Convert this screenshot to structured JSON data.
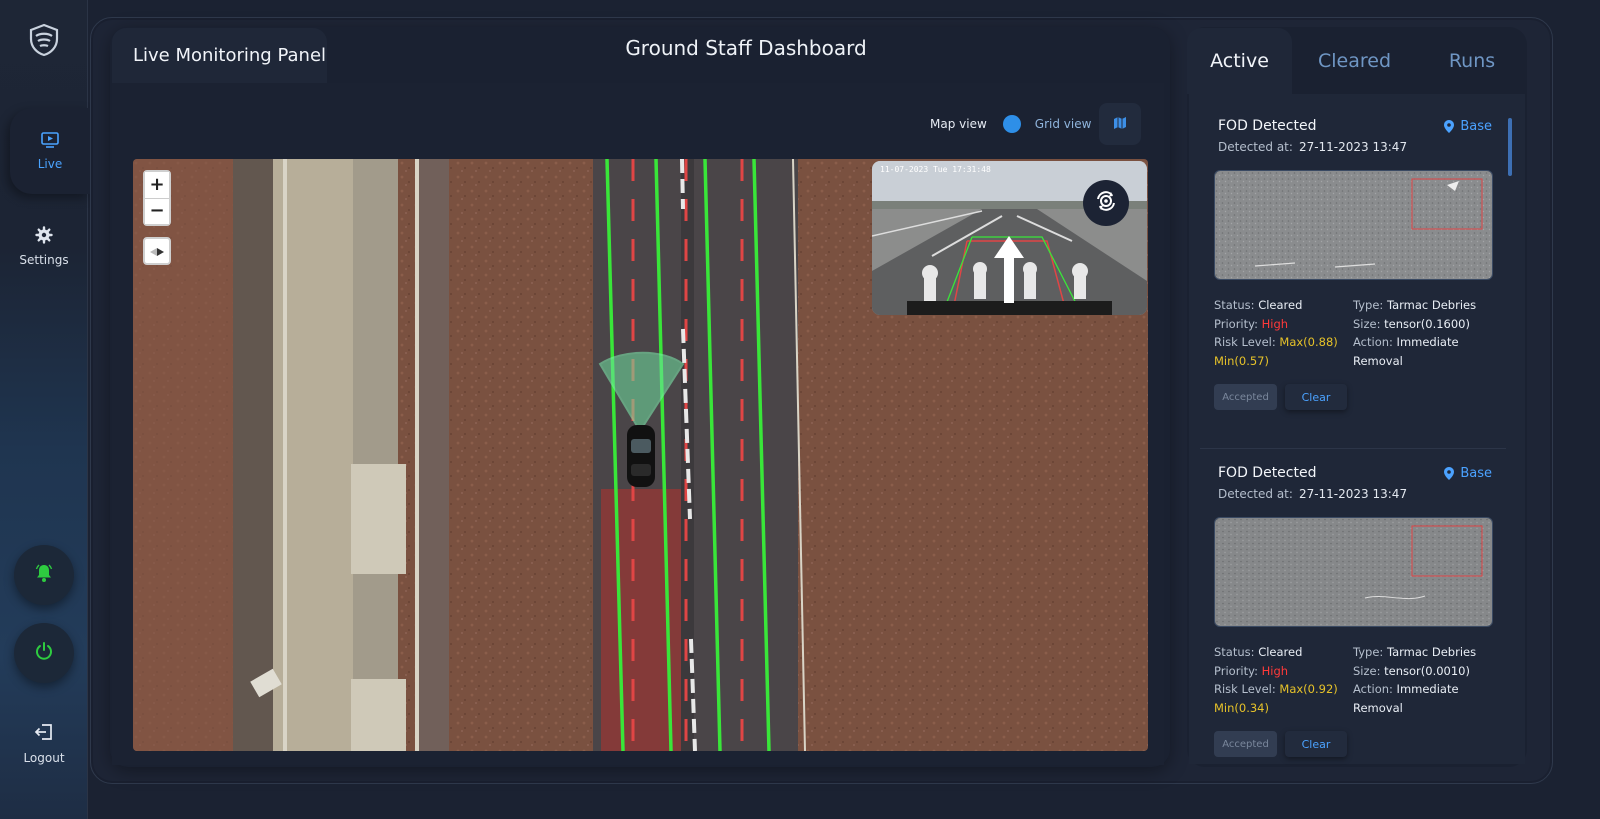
{
  "sidebar": {
    "live_label": "Live",
    "settings_label": "Settings",
    "logout_label": "Logout",
    "accent_color": "#4aa3ff",
    "bell_color": "#2ecc40",
    "power_color": "#2ecc40"
  },
  "header": {
    "live_tab_label": "Live Monitoring Panel",
    "dashboard_title": "Ground Staff Dashboard"
  },
  "view_toggle": {
    "map_label": "Map view",
    "grid_label": "Grid view",
    "selected": "Map view"
  },
  "map": {
    "zoom_in": "+",
    "zoom_out": "−",
    "camera_timestamp": "11-07-2023 Tue 17:31:48"
  },
  "tabs": [
    {
      "label": "Active"
    },
    {
      "label": "Cleared"
    },
    {
      "label": "Runs"
    }
  ],
  "alerts": [
    {
      "title": "FOD Detected",
      "location": "Base",
      "detected_label": "Detected at:",
      "detected_at": "27-11-2023 13:47",
      "status_label": "Status:",
      "status": "Cleared",
      "priority_label": "Priority:",
      "priority": "High",
      "risk_label": "Risk Level:",
      "risk_max": "Max(0.88)",
      "risk_min": "Min(0.57)",
      "type_label": "Type:",
      "type": "Tarmac Debries",
      "size_label": "Size:",
      "size": "tensor(0.1600)",
      "action_label": "Action:",
      "action": "Immediate Removal",
      "accepted_label": "Accepted",
      "clear_label": "Clear"
    },
    {
      "title": "FOD Detected",
      "location": "Base",
      "detected_label": "Detected at:",
      "detected_at": "27-11-2023 13:47",
      "status_label": "Status:",
      "status": "Cleared",
      "priority_label": "Priority:",
      "priority": "High",
      "risk_label": "Risk Level:",
      "risk_max": "Max(0.92)",
      "risk_min": "Min(0.34)",
      "type_label": "Type:",
      "type": "Tarmac Debries",
      "size_label": "Size:",
      "size": "tensor(0.0010)",
      "action_label": "Action:",
      "action": "Immediate Removal",
      "accepted_label": "Accepted",
      "clear_label": "Clear"
    }
  ]
}
